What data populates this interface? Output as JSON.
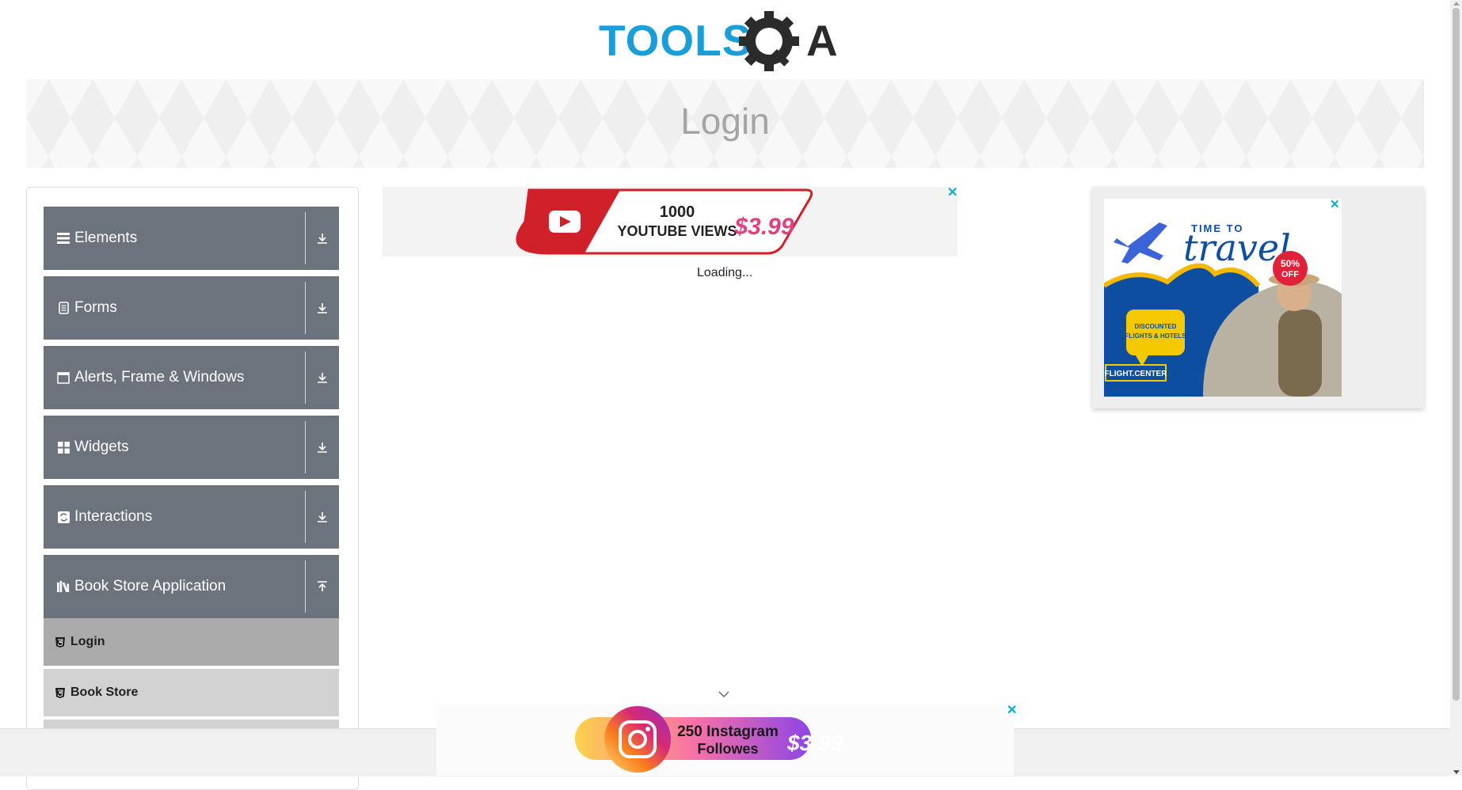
{
  "header": {
    "logo_text_left": "TOOLS",
    "logo_text_right": "QA"
  },
  "page": {
    "title": "Login",
    "loading_text": "Loading..."
  },
  "sidebar": {
    "groups": [
      {
        "label": "Elements",
        "icon": "menu-icon",
        "expanded": false
      },
      {
        "label": "Forms",
        "icon": "form-icon",
        "expanded": false
      },
      {
        "label": "Alerts, Frame & Windows",
        "icon": "window-icon",
        "expanded": false
      },
      {
        "label": "Widgets",
        "icon": "widgets-icon",
        "expanded": false
      },
      {
        "label": "Interactions",
        "icon": "interactions-icon",
        "expanded": false
      },
      {
        "label": "Book Store Application",
        "icon": "books-icon",
        "expanded": true
      }
    ],
    "book_store_items": [
      {
        "label": "Login",
        "active": true
      },
      {
        "label": "Book Store",
        "active": false
      }
    ]
  },
  "ads": {
    "top": {
      "line1": "1000",
      "line2": "YOUTUBE VIEWS",
      "price": "$3.99",
      "close": "✕"
    },
    "right": {
      "headline_small": "TIME TO",
      "headline_large": "travel",
      "discount": "50%",
      "discount_suffix": "OFF",
      "bubble_line1": "DISCOUNTED",
      "bubble_line2": "FLIGHTS & HOTELS",
      "brand": "FLIGHT.CENTER",
      "close": "✕"
    },
    "bottom": {
      "line1": "250 Instagram",
      "line2": "Followes",
      "price": "$3.99",
      "close": "✕"
    }
  },
  "colors": {
    "sidebar_group": "#6c737d",
    "sub_active": "#ababab",
    "sub_item": "#d2d2d2",
    "logo_blue": "#1a9ed8",
    "logo_dark": "#2b2b2b",
    "ad_close": "#00aecd"
  }
}
